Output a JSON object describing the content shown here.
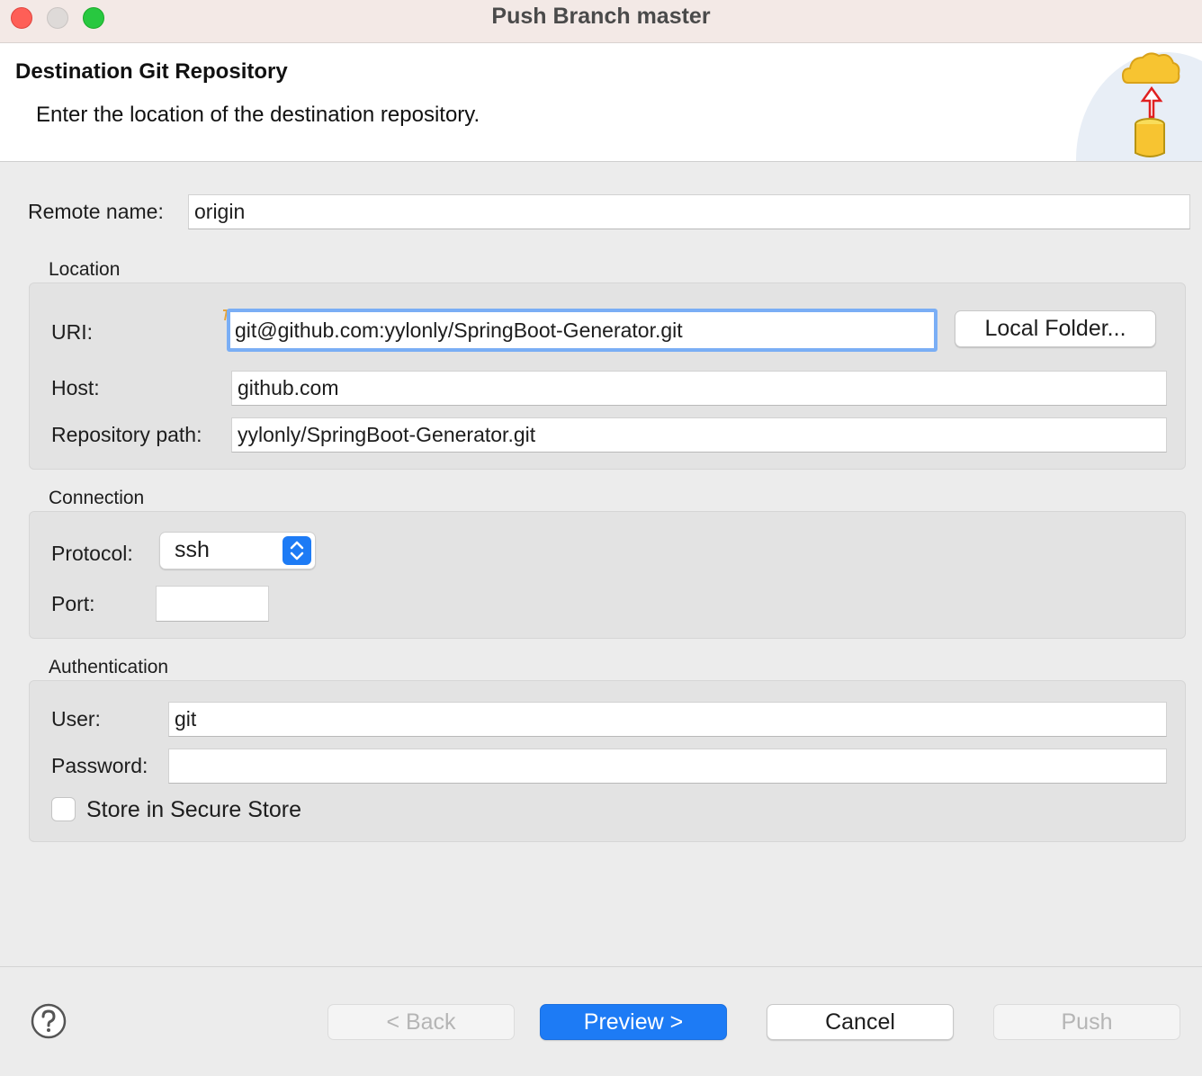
{
  "window": {
    "title": "Push Branch master"
  },
  "header": {
    "title": "Destination Git Repository",
    "description": "Enter the location of the destination repository."
  },
  "remote": {
    "label": "Remote name:",
    "value": "origin"
  },
  "location": {
    "group_title": "Location",
    "uri_label": "URI:",
    "uri_value": "git@github.com:yylonly/SpringBoot-Generator.git",
    "local_folder_button": "Local Folder...",
    "host_label": "Host:",
    "host_value": "github.com",
    "repo_path_label": "Repository path:",
    "repo_path_value": "yylonly/SpringBoot-Generator.git"
  },
  "connection": {
    "group_title": "Connection",
    "protocol_label": "Protocol:",
    "protocol_value": "ssh",
    "port_label": "Port:",
    "port_value": ""
  },
  "authentication": {
    "group_title": "Authentication",
    "user_label": "User:",
    "user_value": "git",
    "password_label": "Password:",
    "password_value": "",
    "store_label": "Store in Secure Store",
    "store_checked": false
  },
  "footer": {
    "back_label": "< Back",
    "preview_label": "Preview >",
    "cancel_label": "Cancel",
    "push_label": "Push"
  },
  "colors": {
    "accent": "#1d7bf5",
    "close": "#fe5f57",
    "zoom": "#28c840",
    "cloud": "#f7c431",
    "arrow": "#e02020"
  },
  "icons": {
    "header": "push-to-cloud-icon",
    "help": "help-icon",
    "select": "chevron-up-down-icon"
  }
}
